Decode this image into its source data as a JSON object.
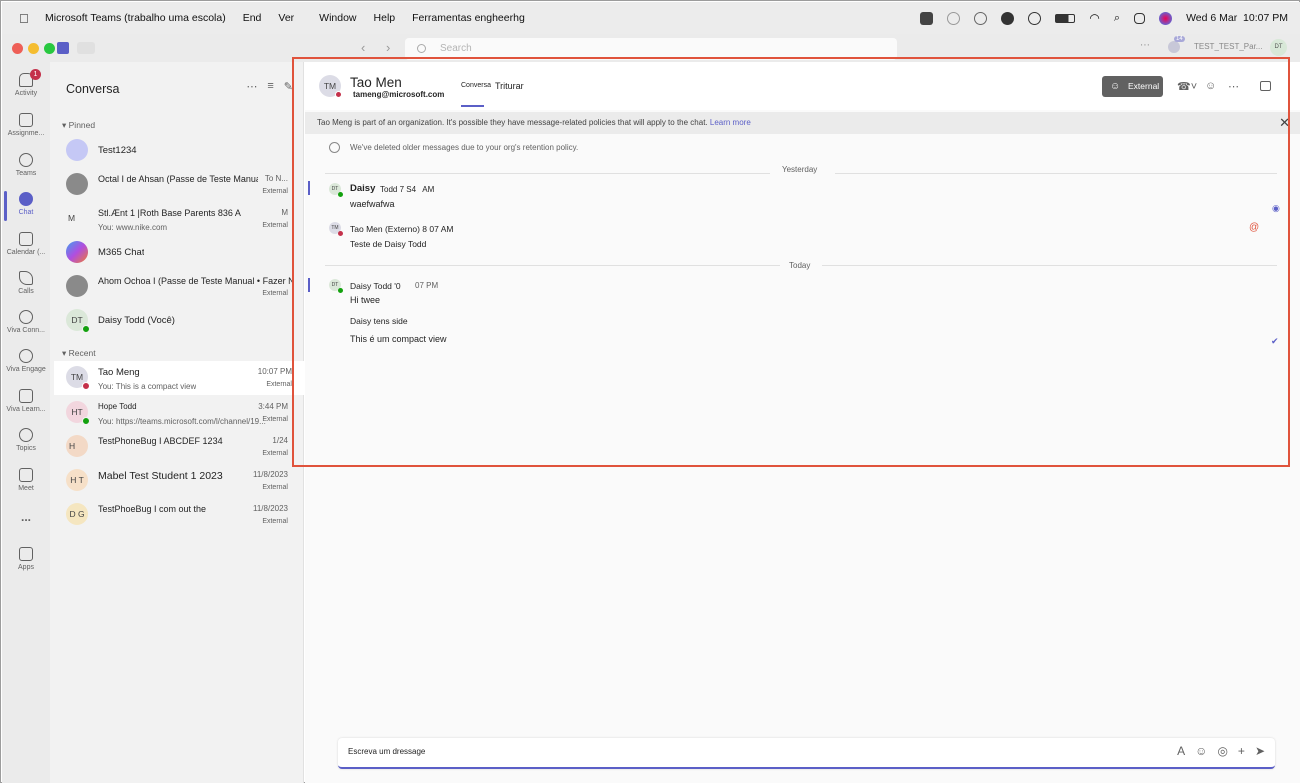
{
  "menubar": {
    "app": "Microsoft Teams (trabalho uma escola)",
    "items": [
      "End",
      "Ver",
      "Window",
      "Help",
      "Ferramentas engheerhg"
    ],
    "datetime": "Wed 6 Mar  10:07 PM"
  },
  "titlebar": {
    "search_placeholder": "Search",
    "user": "TEST_TEST_Par...",
    "user_initials": "DT",
    "notif_count": "14"
  },
  "rail": {
    "items": [
      {
        "label": "Activity",
        "badge": "1"
      },
      {
        "label": "Assignme..."
      },
      {
        "label": "Teams"
      },
      {
        "label": "Chat"
      },
      {
        "label": "Calendar (..."
      },
      {
        "label": "Calls"
      },
      {
        "label": "Viva Conn..."
      },
      {
        "label": "Viva Engage"
      },
      {
        "label": "Viva Learn..."
      },
      {
        "label": "Topics"
      },
      {
        "label": "Meet"
      },
      {
        "label": "..."
      },
      {
        "label": "Apps"
      }
    ]
  },
  "list": {
    "title": "Conversa",
    "pinned_label": "Pinned",
    "recent_label": "Recent",
    "pinned": [
      {
        "name": "Test1234",
        "initials": "",
        "time": "",
        "preview": "",
        "ext": ""
      },
      {
        "name": "Octal I de Ahsan (Passe de Teste Manual)",
        "initials": "",
        "time": "To N...",
        "preview": "",
        "ext": "External"
      },
      {
        "name": "Stl.Ænt 1 |Roth Base Parents 836 A",
        "initials": "M",
        "time": "M",
        "preview": "You: www.nike.com",
        "ext": "External"
      },
      {
        "name": "M365 Chat",
        "initials": "",
        "time": "",
        "preview": "",
        "ext": ""
      },
      {
        "name": "Ahom Ochoa I (Passe de Teste Manual • Fazer N",
        "initials": "",
        "time": "",
        "preview": "",
        "ext": "External"
      },
      {
        "name": "Daisy Todd (Você)",
        "initials": "DT",
        "time": "",
        "preview": "",
        "ext": ""
      }
    ],
    "recent": [
      {
        "name": "Tao Meng",
        "initials": "TM",
        "time": "10:07 PM",
        "preview": "You: This is a compact view",
        "ext": "External"
      },
      {
        "name": "Hope Todd",
        "initials": "HT",
        "time": "3:44 PM",
        "preview": "You: https://teams.microsoft.com/l/channel/19...",
        "ext": "External"
      },
      {
        "name": "TestPhoneBug I ABCDEF 1234",
        "initials": "H",
        "time": "1/24",
        "preview": "",
        "ext": "External"
      },
      {
        "name": "Mabel Test Student 1 2023",
        "initials": "H T",
        "time": "11/8/2023",
        "preview": "",
        "ext": "External"
      },
      {
        "name": "TestPhoeBug I com   out the",
        "initials": "D G",
        "time": "11/8/2023",
        "preview": "",
        "ext": "External"
      }
    ]
  },
  "header": {
    "initials": "TM",
    "name": "Tao Men",
    "email": "tameng@microsoft.com",
    "tabs": [
      "Conversa",
      "Triturar"
    ],
    "external_label": "External"
  },
  "banner": {
    "text": "Tao Meng is part of an organization. It's possible they have message-related policies that will apply to the chat.",
    "link": "Learn more"
  },
  "conversation": {
    "retention": "We've deleted older messages due to your org's retention policy.",
    "yesterday": "Yesterday",
    "today": "Today",
    "messages": [
      {
        "author": "Daisy",
        "meta": "Todd 7 S4   AM",
        "text": "waefwafwa"
      },
      {
        "author": "Tao Men (Externo) 8 07 AM",
        "meta": "",
        "text": "Teste de Daisy Todd"
      },
      {
        "author": "Daisy Todd '0",
        "meta": "07 PM",
        "text": "Hi twee"
      },
      {
        "author": "",
        "meta": "",
        "text": "Daisy tens side"
      },
      {
        "author": "",
        "meta": "",
        "text": "This é um compact view"
      }
    ]
  },
  "compose": {
    "placeholder": "Escreva um dressage"
  },
  "colors": {
    "accent": "#5b5fc7",
    "highlight": "#e0533c",
    "busy": "#c4314b",
    "available": "#13a10e"
  }
}
